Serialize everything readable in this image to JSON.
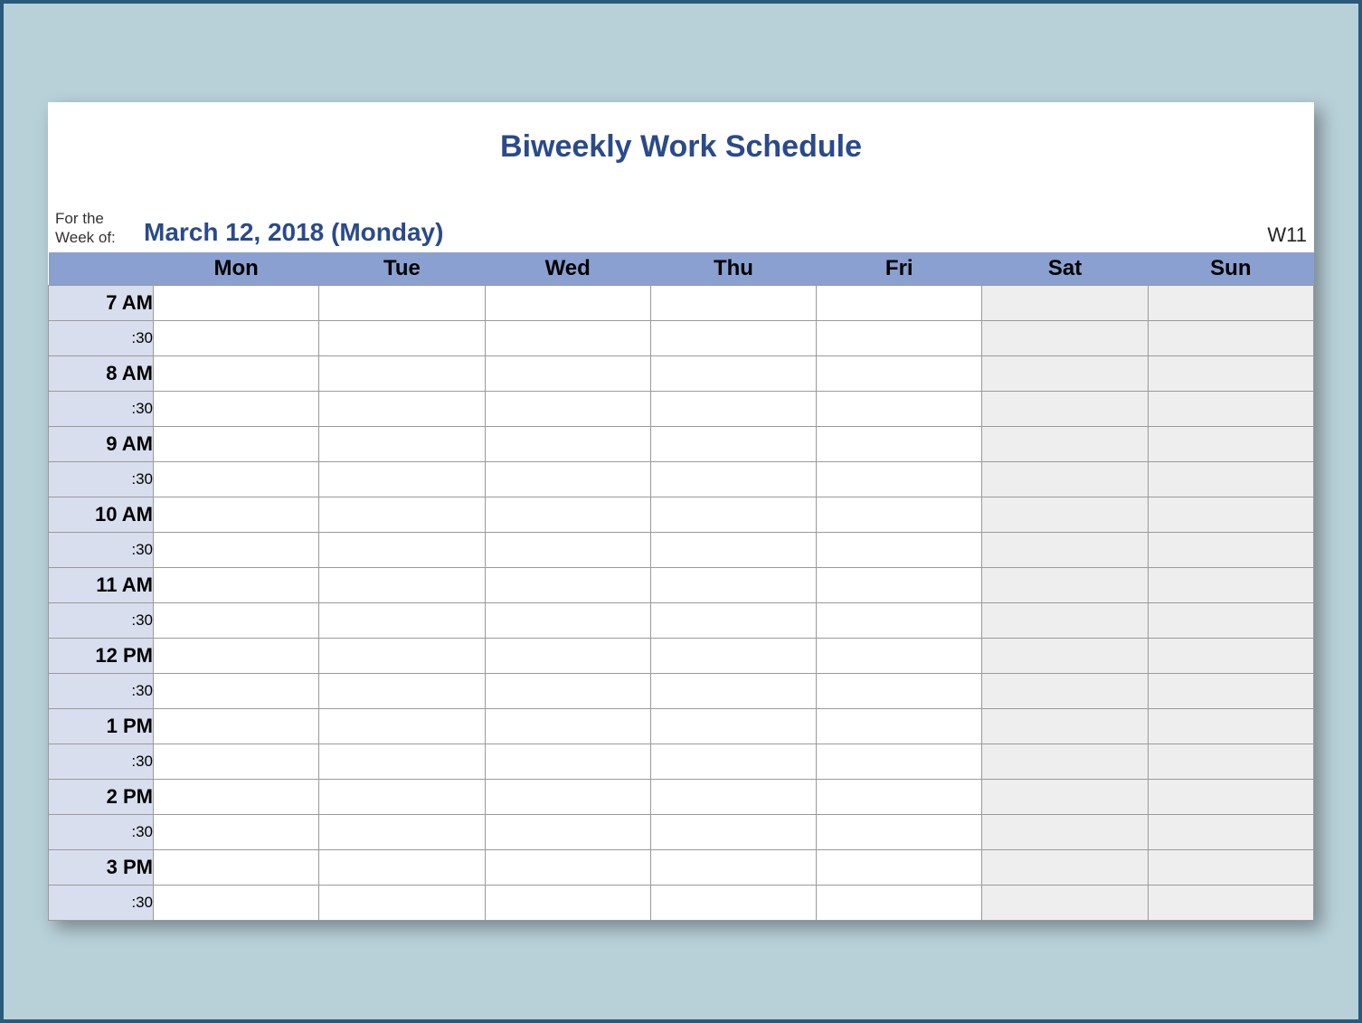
{
  "title": "Biweekly Work Schedule",
  "meta": {
    "label_line1": "For the",
    "label_line2": "Week of:",
    "date": "March 12, 2018 (Monday)",
    "week_number": "W11"
  },
  "days": [
    "Mon",
    "Tue",
    "Wed",
    "Thu",
    "Fri",
    "Sat",
    "Sun"
  ],
  "weekend_days": [
    "Sat",
    "Sun"
  ],
  "time_rows": [
    {
      "hour": "7 AM",
      "half": ":30"
    },
    {
      "hour": "8 AM",
      "half": ":30"
    },
    {
      "hour": "9 AM",
      "half": ":30"
    },
    {
      "hour": "10 AM",
      "half": ":30"
    },
    {
      "hour": "11 AM",
      "half": ":30"
    },
    {
      "hour": "12 PM",
      "half": ":30"
    },
    {
      "hour": "1 PM",
      "half": ":30"
    },
    {
      "hour": "2 PM",
      "half": ":30"
    },
    {
      "hour": "3 PM",
      "half": ":30"
    }
  ]
}
